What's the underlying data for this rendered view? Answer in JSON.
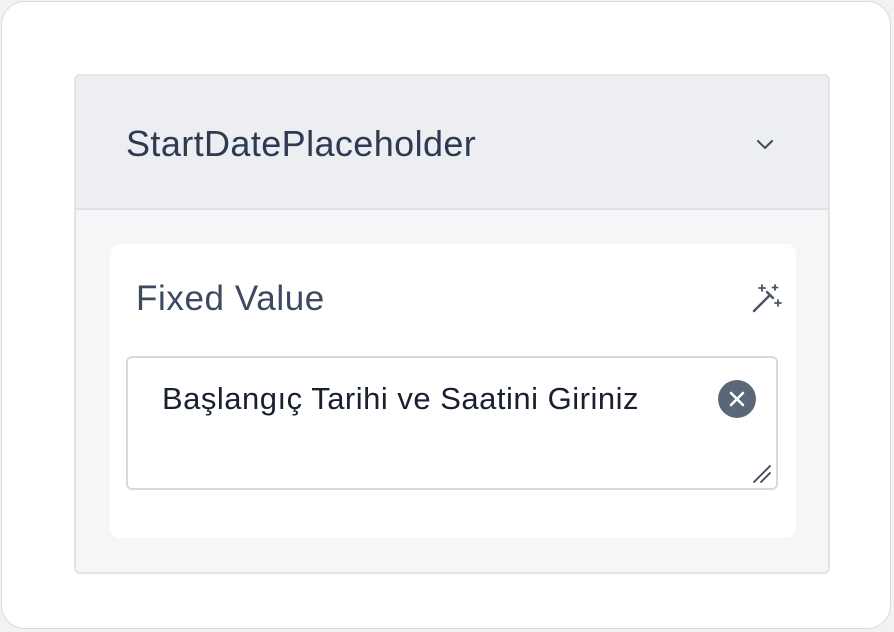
{
  "panel": {
    "title": "StartDatePlaceholder",
    "toggle_icon": "chevron-down-icon"
  },
  "field": {
    "label": "Fixed Value",
    "action_icon": "magic-wand-icon",
    "value": "Başlangıç Tarihi ve Saatini Giriniz",
    "clear_icon": "clear-icon",
    "resize_icon": "resize-handle-icon"
  },
  "colors": {
    "title_text": "#2c3a52",
    "header_bg": "#eceef1",
    "panel_bg": "#f5f6f8",
    "clear_button": "#5b6677"
  }
}
